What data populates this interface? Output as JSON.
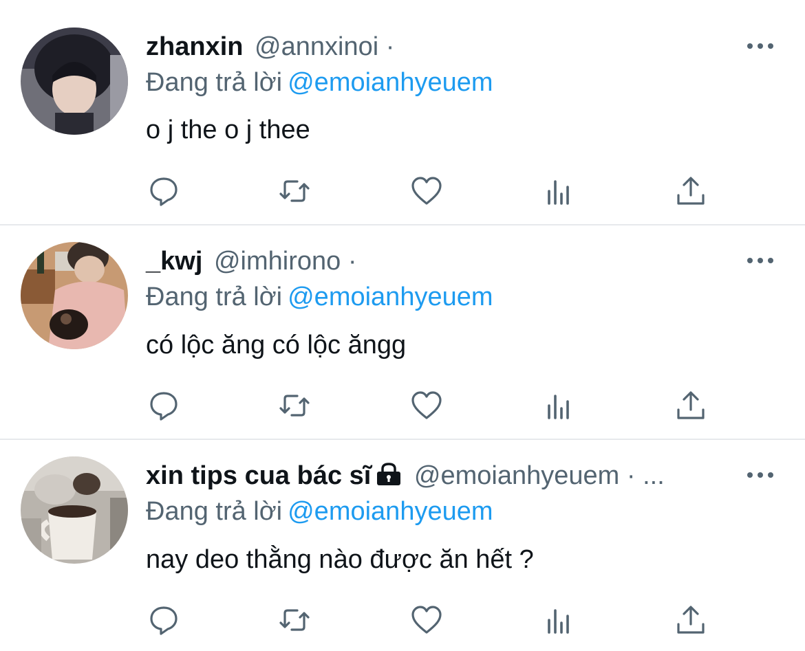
{
  "colors": {
    "accent": "#1d9bf0",
    "secondary_text": "#536471",
    "divider": "#e6e9ec"
  },
  "tweets": [
    {
      "display_name": "zhanxin",
      "handle": "@annxinoi",
      "separator": "·",
      "reply_prefix": "Đang trả lời",
      "reply_to": "@emoianhyeuem",
      "text": "o j the o j thee",
      "avatar": "profile-photo"
    },
    {
      "display_name": "_kwj",
      "handle": "@imhirono",
      "separator": "·",
      "reply_prefix": "Đang trả lời",
      "reply_to": "@emoianhyeuem",
      "text": "có lộc ăng có lộc ăngg",
      "avatar": "profile-photo"
    },
    {
      "display_name": "xin tips cua bác sĩ",
      "handle": "@emoianhyeuem",
      "separator": "·",
      "overflow": "...",
      "protected_icon": "lock-icon",
      "reply_prefix": "Đang trả lời",
      "reply_to": "@emoianhyeuem",
      "text": "nay deo thằng nào được ăn hết ?",
      "avatar": "profile-photo"
    }
  ],
  "action_icons": [
    "reply-icon",
    "retweet-icon",
    "like-icon",
    "views-icon",
    "share-icon"
  ],
  "more_icon": "more-options-icon"
}
